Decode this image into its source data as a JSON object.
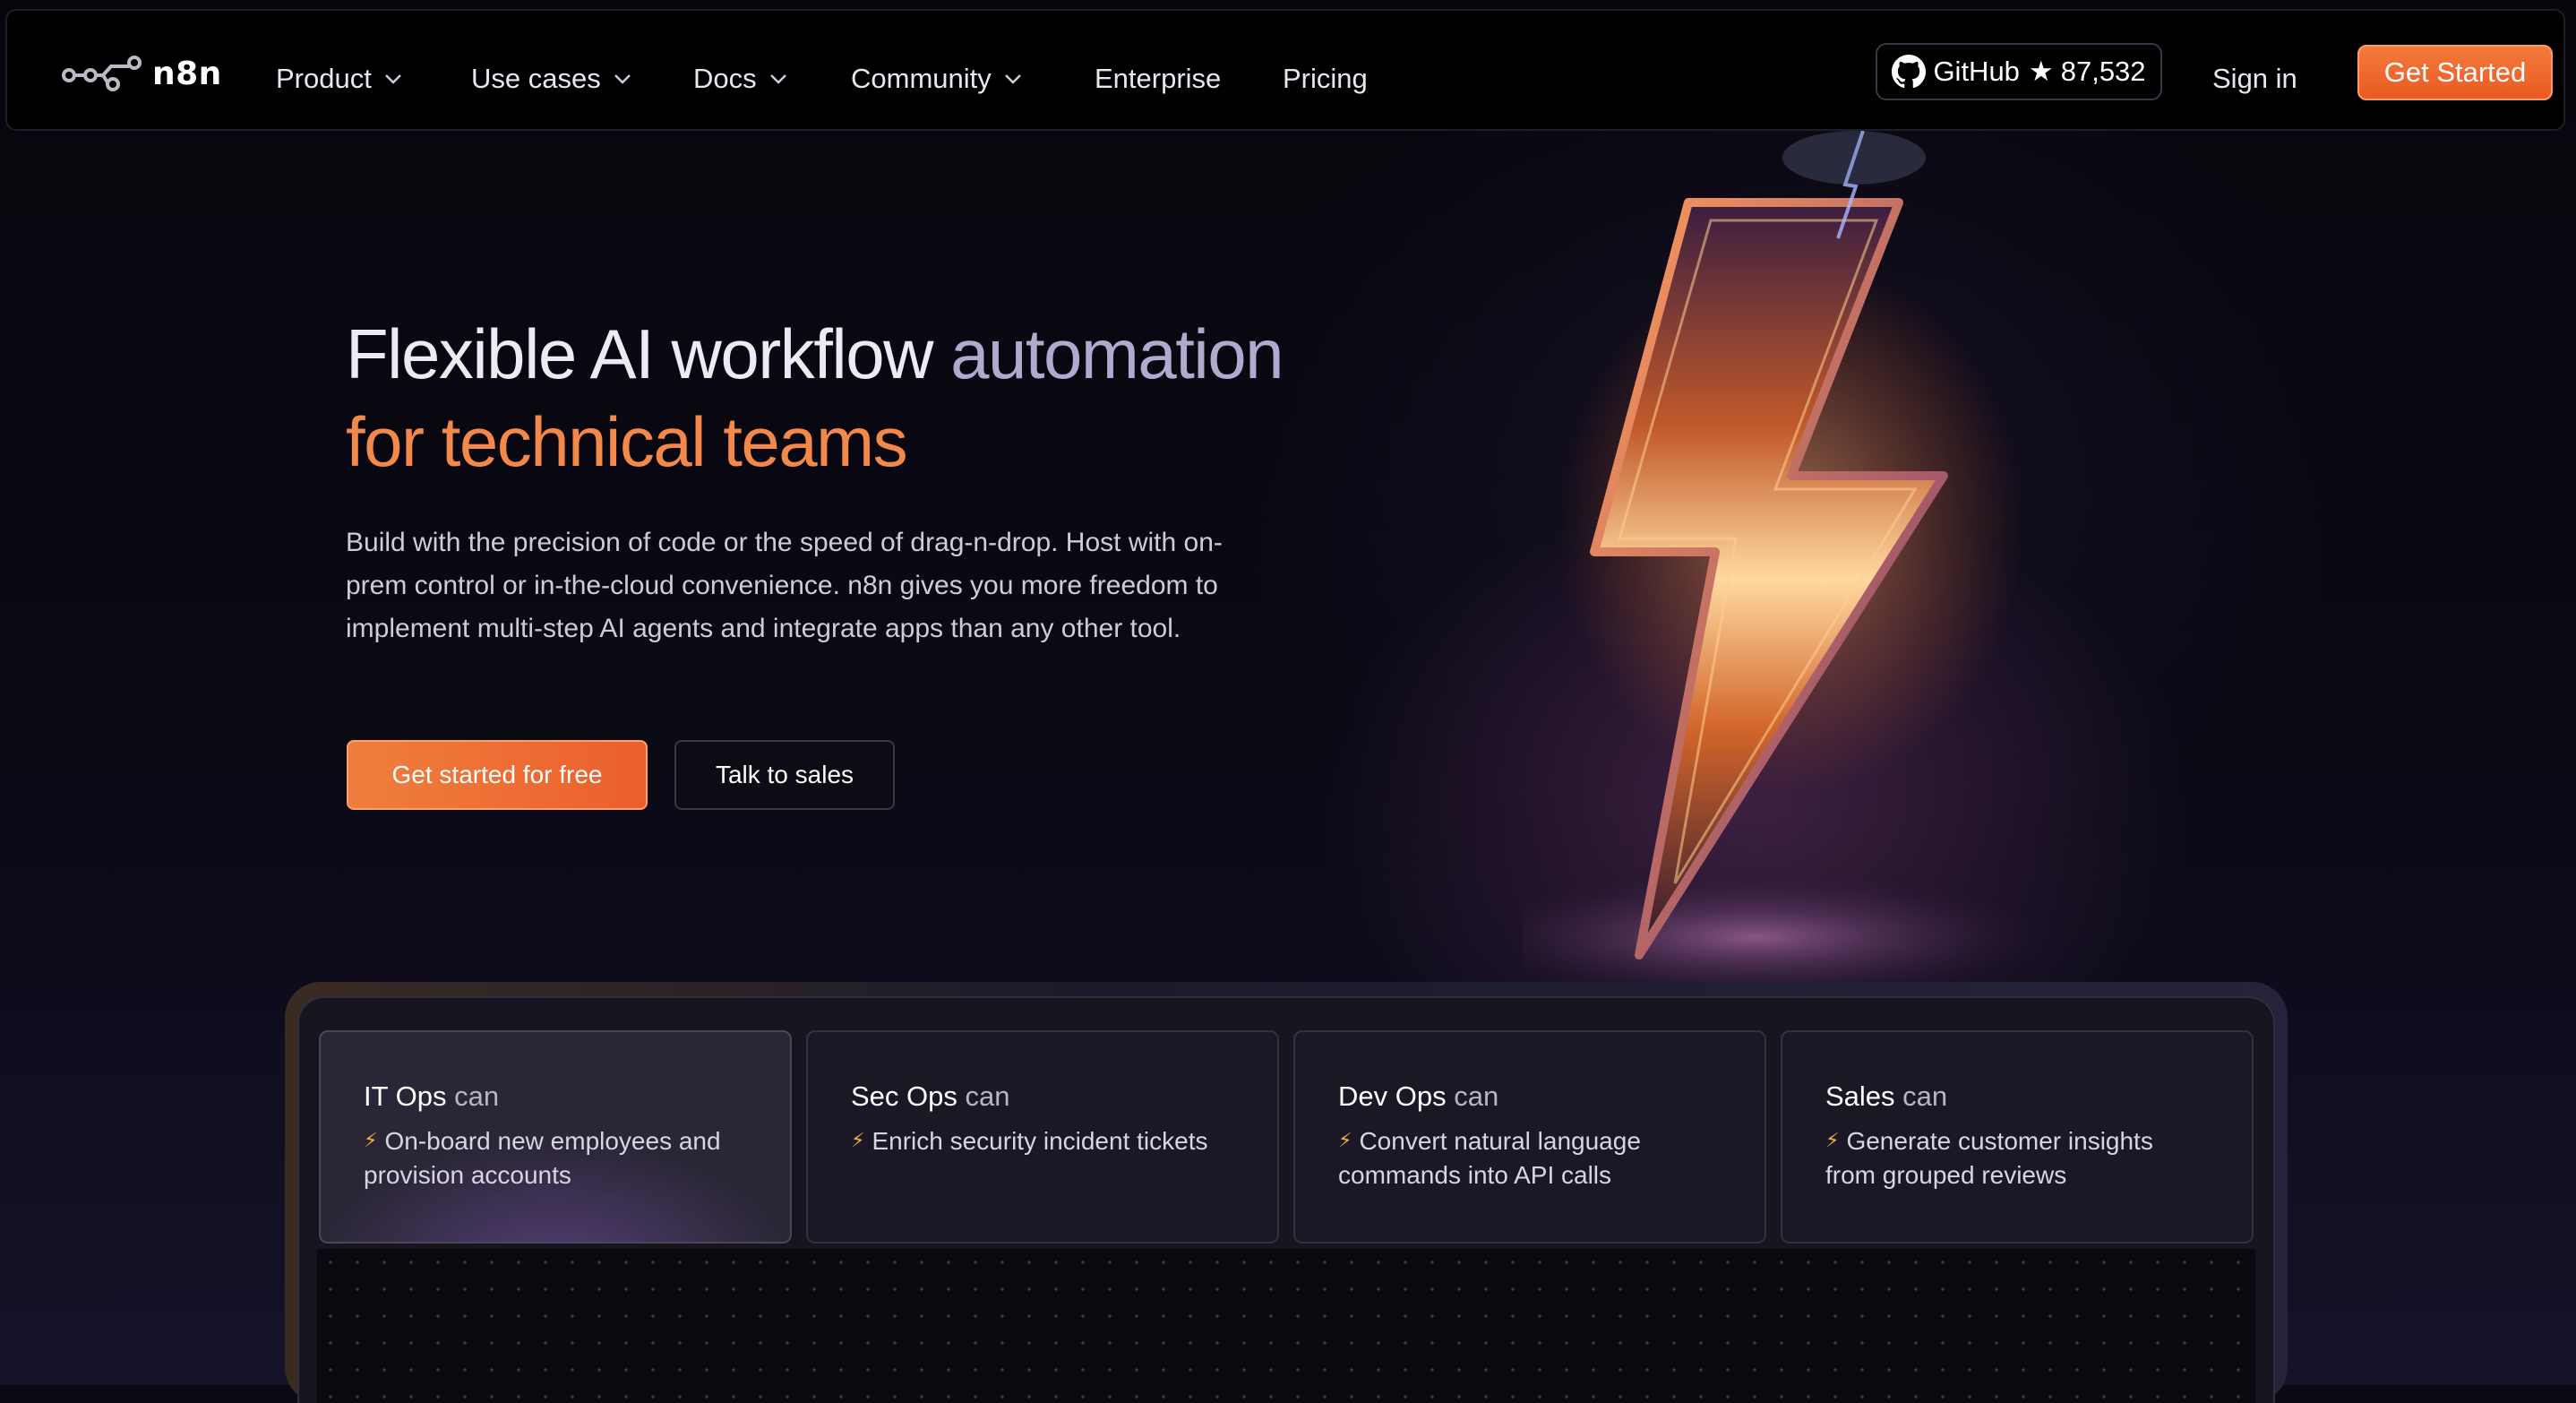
{
  "colors": {
    "accent": "#ec5f2c",
    "accent_light": "#f2884a",
    "lilac": "#b3a9cf",
    "background": "#0b0a14"
  },
  "nav": {
    "logo_text": "n8n",
    "items": [
      {
        "label": "Product",
        "has_dropdown": true
      },
      {
        "label": "Use cases",
        "has_dropdown": true
      },
      {
        "label": "Docs",
        "has_dropdown": true
      },
      {
        "label": "Community",
        "has_dropdown": true
      },
      {
        "label": "Enterprise",
        "has_dropdown": false
      },
      {
        "label": "Pricing",
        "has_dropdown": false
      }
    ],
    "github": {
      "label": "GitHub",
      "star_icon": "star-icon",
      "stars": "87,532"
    },
    "signin_label": "Sign in",
    "get_started_label": "Get Started"
  },
  "hero": {
    "title_part1": "Flexible AI workflow ",
    "title_part2": "automation",
    "title_line2": "for technical teams",
    "description": "Build with the precision of code or the speed of drag-n-drop. Host with on-prem control or in-the-cloud convenience. n8n gives you more freedom to implement multi-step AI agents and integrate apps than any other tool.",
    "cta_primary": "Get started for free",
    "cta_secondary": "Talk to sales"
  },
  "cards": [
    {
      "role": "IT Ops",
      "can": "can",
      "text": "On-board new employees and provision accounts",
      "active": true
    },
    {
      "role": "Sec Ops",
      "can": "can",
      "text": "Enrich security incident tickets",
      "active": false
    },
    {
      "role": "Dev Ops",
      "can": "can",
      "text": "Convert natural language commands into API calls",
      "active": false
    },
    {
      "role": "Sales",
      "can": "can",
      "text": "Generate customer insights from grouped reviews",
      "active": false
    }
  ],
  "card_icon": "⚡"
}
